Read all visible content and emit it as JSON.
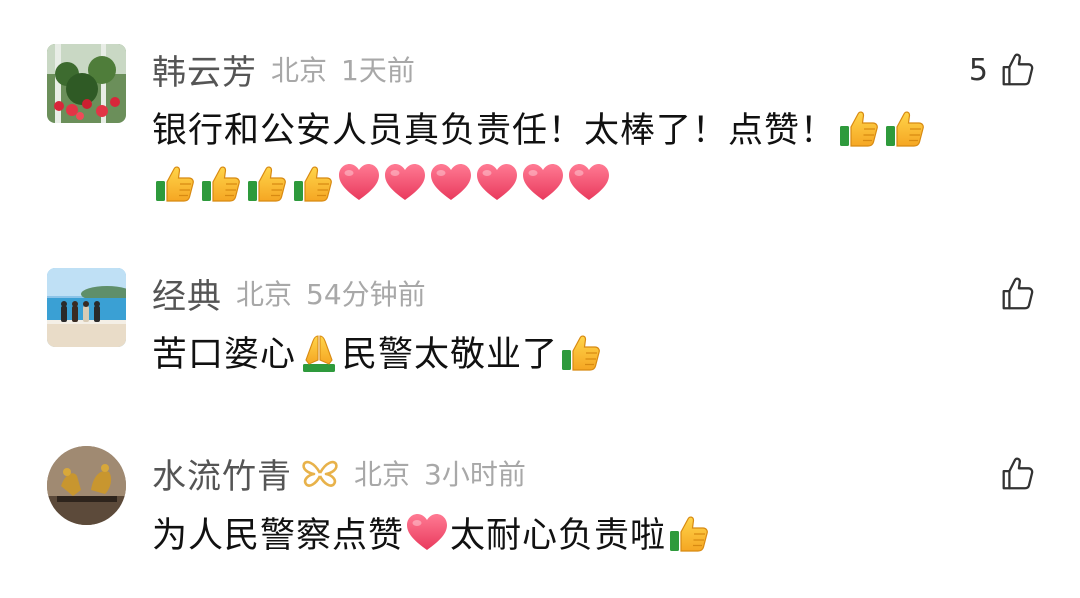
{
  "comments": [
    {
      "username": "韩云芳",
      "location": "北京",
      "time": "1天前",
      "like_count": "5",
      "line1": "银行和公安人员真负责任！太棒了！点赞！",
      "line1_emojis": [
        "thumbs-up",
        "thumbs-up"
      ],
      "line2_emojis": [
        "thumbs-up",
        "thumbs-up",
        "thumbs-up",
        "thumbs-up",
        "heart",
        "heart",
        "heart",
        "heart",
        "heart",
        "heart"
      ]
    },
    {
      "username": "经典",
      "location": "北京",
      "time": "54分钟前",
      "like_count": "",
      "text_a": "苦口婆心",
      "emoji_a": "praying-hands",
      "text_b": "民警太敬业了",
      "emoji_b": "thumbs-up"
    },
    {
      "username": "水流竹青",
      "location": "北京",
      "time": "3小时前",
      "like_count": "",
      "badge": "butterfly-badge",
      "text_a": "为人民警察点赞",
      "emoji_a": "heart",
      "text_b": "太耐心负责啦",
      "emoji_b": "thumbs-up"
    }
  ],
  "colors": {
    "username": "#555555",
    "meta": "#a8a8a8",
    "text": "#111111",
    "badge": "#e8b24a",
    "heart": "#f0506e"
  }
}
